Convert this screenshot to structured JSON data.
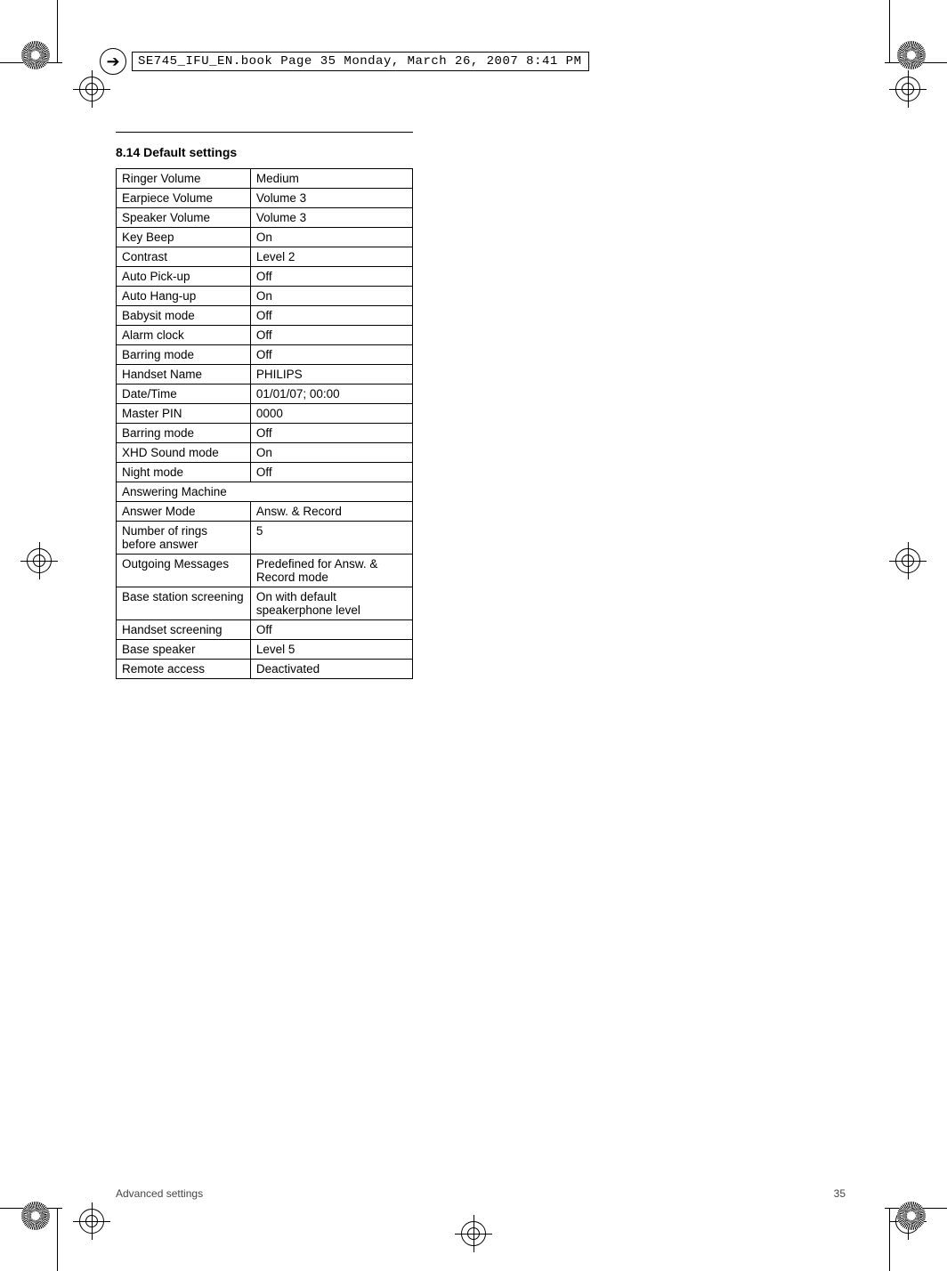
{
  "header": {
    "text": "SE745_IFU_EN.book  Page 35  Monday, March 26, 2007  8:41 PM"
  },
  "section": {
    "title": "8.14 Default settings"
  },
  "rows": {
    "r0": {
      "k": "Ringer Volume",
      "v": "Medium"
    },
    "r1": {
      "k": "Earpiece Volume",
      "v": "Volume 3"
    },
    "r2": {
      "k": "Speaker Volume",
      "v": "Volume 3"
    },
    "r3": {
      "k": "Key Beep",
      "v": "On"
    },
    "r4": {
      "k": "Contrast",
      "v": "Level 2"
    },
    "r5": {
      "k": "Auto Pick-up",
      "v": "Off"
    },
    "r6": {
      "k": "Auto Hang-up",
      "v": "On"
    },
    "r7": {
      "k": "Babysit mode",
      "v": "Off"
    },
    "r8": {
      "k": "Alarm clock",
      "v": "Off"
    },
    "r9": {
      "k": "Barring mode",
      "v": "Off"
    },
    "r10": {
      "k": "Handset Name",
      "v": "PHILIPS"
    },
    "r11": {
      "k": "Date/Time",
      "v": "01/01/07; 00:00"
    },
    "r12": {
      "k": "Master PIN",
      "v": "0000"
    },
    "r13": {
      "k": "Barring mode",
      "v": "Off"
    },
    "r14": {
      "k": "XHD Sound mode",
      "v": "On"
    },
    "r15": {
      "k": "Night mode",
      "v": "Off"
    },
    "r16": {
      "k": "Answering Machine"
    },
    "r17": {
      "k": "Answer Mode",
      "v": "Answ. & Record"
    },
    "r18": {
      "k": "Number of rings before answer",
      "v": "5"
    },
    "r19": {
      "k": "Outgoing Messages",
      "v": "Predefined for Answ. & Record mode"
    },
    "r20": {
      "k": "Base station screening",
      "v": "On with default speakerphone level"
    },
    "r21": {
      "k": "Handset screening",
      "v": "Off"
    },
    "r22": {
      "k": "Base speaker",
      "v": "Level 5"
    },
    "r23": {
      "k": "Remote access",
      "v": "Deactivated"
    }
  },
  "footer": {
    "left": "Advanced settings",
    "right": "35"
  }
}
